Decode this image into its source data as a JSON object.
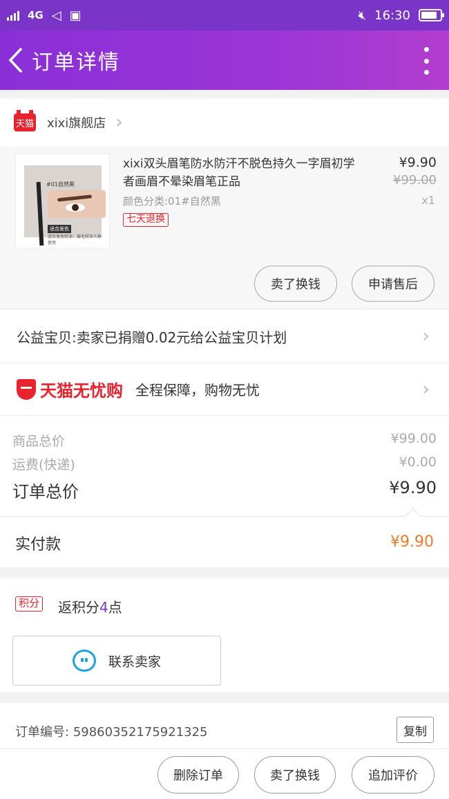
{
  "status_bar": {
    "network": "4G",
    "time": "16:30",
    "battery_level": 0.85
  },
  "nav": {
    "title": "订单详情"
  },
  "store": {
    "name": "xixi旗舰店",
    "badge": "天猫"
  },
  "product": {
    "image_label": "#01自然黑",
    "image_tag": "适合发色",
    "image_caption": "适合发色较深、眉毛较浓人群使用",
    "title": "xixi双头眉笔防水防汗不脱色持久一字眉初学者画眉不晕染眉笔正品",
    "spec": "颜色分类:01#自然黑",
    "return_tag": "七天退换",
    "price": "¥9.90",
    "original_price": "¥99.00",
    "quantity": "x1",
    "actions": {
      "exchange": "卖了换钱",
      "after_sales": "申请售后"
    }
  },
  "charity": {
    "text": "公益宝贝:卖家已捐赠0.02元给公益宝贝计划"
  },
  "worry_free": {
    "logo_text": "天猫无忧购",
    "text": "全程保障，购物无忧"
  },
  "totals": {
    "goods_label": "商品总价",
    "goods_value": "¥99.00",
    "shipping_label": "运费(快递)",
    "shipping_value": "¥0.00",
    "order_label": "订单总价",
    "order_value": "¥9.90"
  },
  "paid": {
    "label": "实付款",
    "value": "¥9.90"
  },
  "points": {
    "badge": "积分",
    "prefix": "返积分",
    "count": "4",
    "suffix": "点"
  },
  "contact": {
    "label": "联系卖家"
  },
  "order": {
    "number_label": "订单编号:",
    "number": "59860352175921325",
    "copy": "复制"
  },
  "bottom_bar": {
    "delete": "删除订单",
    "exchange": "卖了换钱",
    "review": "追加评价"
  },
  "colors": {
    "brand": "#8a2fd8",
    "tmall_red": "#e8232d",
    "paid_orange": "#f2782a"
  }
}
